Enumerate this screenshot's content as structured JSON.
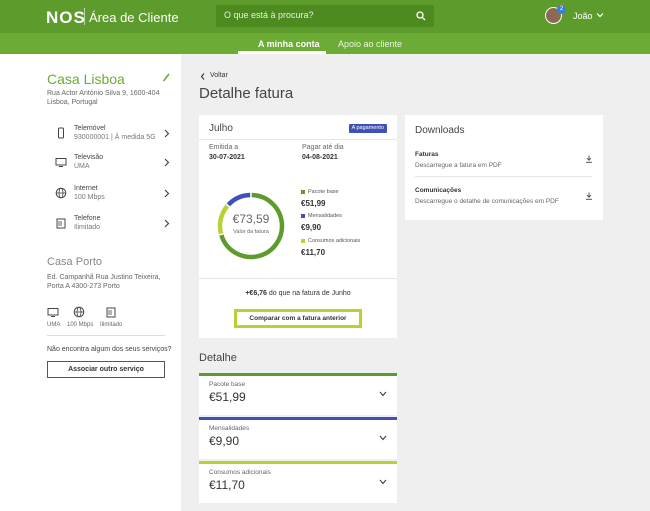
{
  "header": {
    "logo": "NOS",
    "app_title": "Área de Cliente",
    "search_placeholder": "O que está à procura?",
    "user_name": "João",
    "notification_count": "2"
  },
  "nav": {
    "tabs": [
      {
        "label": "A minha conta",
        "active": true
      },
      {
        "label": "Apoio ao cliente",
        "active": false
      }
    ]
  },
  "sidebar": {
    "home": {
      "title": "Casa Lisboa",
      "address_line1": "Rua Actor António Silva 9, 1600-404",
      "address_line2": "Lisboa, Portugal",
      "services": [
        {
          "icon": "mobile-icon",
          "title": "Telemóvel",
          "sub": "930000001 | À medida 5G"
        },
        {
          "icon": "tv-icon",
          "title": "Televisão",
          "sub": "UMA"
        },
        {
          "icon": "globe-icon",
          "title": "Internet",
          "sub": "100 Mbps"
        },
        {
          "icon": "phone-icon",
          "title": "Telefone",
          "sub": "Ilimitado"
        }
      ]
    },
    "porto": {
      "title": "Casa Porto",
      "address_line1": "Ed. Campanhã Rua Justino Teixeira,",
      "address_line2": "Porta A 4300-273 Porto",
      "services": [
        {
          "icon": "tv-icon",
          "label": "UMA"
        },
        {
          "icon": "globe-icon",
          "label": "100 Mbps"
        },
        {
          "icon": "phone-icon",
          "label": "Ilimitado"
        }
      ]
    },
    "missing_text": "Não encontra algum dos seus serviços?",
    "associate_button": "Associar outro serviço"
  },
  "main": {
    "back_label": "Voltar",
    "page_title": "Detalhe fatura",
    "bill": {
      "month": "Julho",
      "status_badge": "A pagamento",
      "issued_label": "Emitida a",
      "issued_value": "30-07-2021",
      "due_label": "Pagar até dia",
      "due_value": "04-08-2021",
      "total": "€73,59",
      "total_label": "Valor da fatura",
      "breakdown": [
        {
          "name": "Pacote base",
          "value": "€51,99",
          "color": "#5d9b2d"
        },
        {
          "name": "Mensalidades",
          "value": "€9,90",
          "color": "#3f51b5"
        },
        {
          "name": "Consumos adicionais",
          "value": "€11,70",
          "color": "#b5d334"
        }
      ],
      "compare_amount": "+€6,76",
      "compare_suffix": "do que na fatura de Junho",
      "compare_button": "Comparar com a fatura anterior"
    },
    "downloads": {
      "title": "Downloads",
      "items": [
        {
          "title": "Faturas",
          "sub": "Descarregue a fatura em PDF"
        },
        {
          "title": "Comunicações",
          "sub": "Descarregue o detalhe de comunicações em PDF"
        }
      ]
    },
    "detail": {
      "title": "Detalhe",
      "items": [
        {
          "name": "Pacote base",
          "value": "€51,99",
          "color": "#5d9b2d"
        },
        {
          "name": "Mensalidades",
          "value": "€9,90",
          "color": "#3f51b5"
        },
        {
          "name": "Consumos adicionais",
          "value": "€11,70",
          "color": "#b5d334"
        }
      ]
    }
  }
}
